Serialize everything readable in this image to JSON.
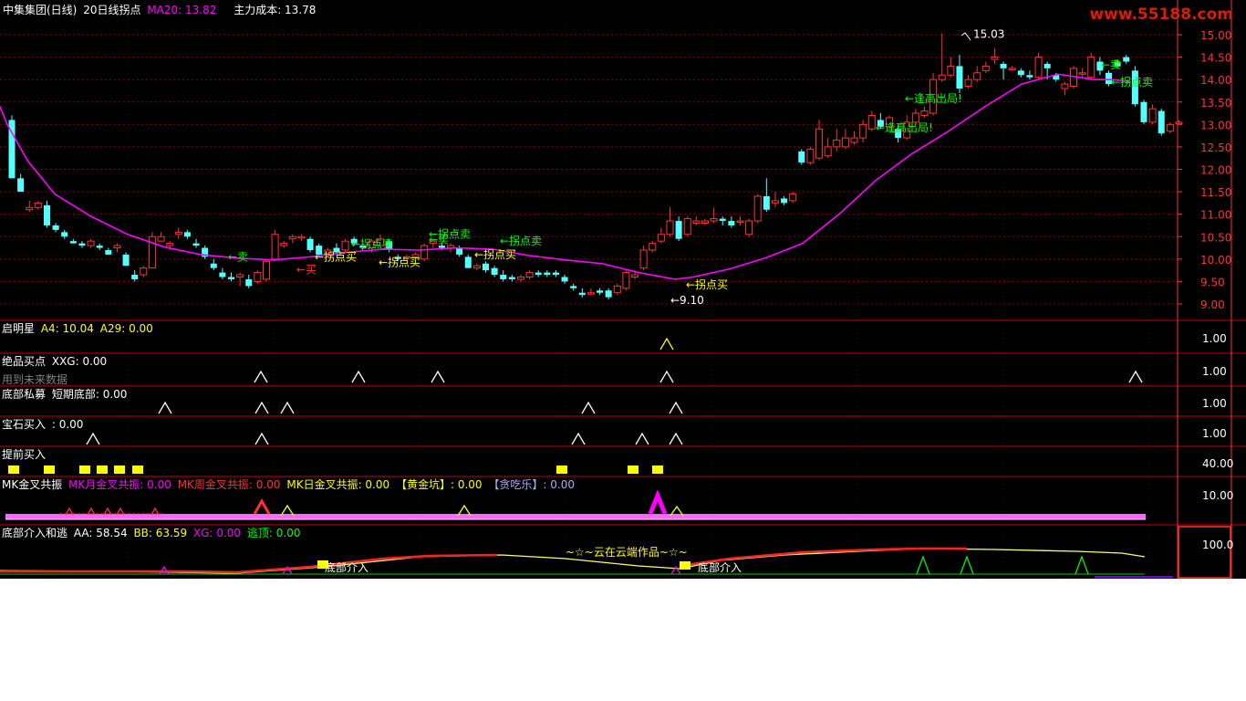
{
  "header": {
    "stock": "中集集团(日线)",
    "indicator": "20日线拐点",
    "ma_label": "MA20: 13.82",
    "cost_label": "主力成本: 13.78"
  },
  "watermark": "www.55188.com",
  "panels": {
    "p1": {
      "title": "启明星",
      "a": "A4: 10.04",
      "b": "A29: 0.00",
      "axis": "1.00"
    },
    "p2": {
      "title": "绝品买点",
      "a": "XXG: 0.00",
      "note": "用到未来数据",
      "axis": "1.00"
    },
    "p3": {
      "title": "底部私募",
      "a": "短期底部: 0.00",
      "axis": "1.00"
    },
    "p4": {
      "title": "宝石买入",
      "a": ": 0.00",
      "axis": "1.00"
    },
    "p5": {
      "title": "提前买入",
      "axis": "40.00"
    },
    "p6": {
      "title": "MK金叉共振",
      "a": "MK月金叉共振: 0.00",
      "b": "MK周金叉共振: 0.00",
      "c": "MK日金叉共振: 0.00",
      "d": "【黄金坑】: 0.00",
      "e": "【贪吃乐】: 0.00",
      "axis": "10.00"
    },
    "p7": {
      "title": "底部介入和逃",
      "a": "AA: 58.54",
      "b": "BB: 63.59",
      "c": "XG: 0.00",
      "d": "逃顶: 0.00",
      "axis": "100.0",
      "credit": "~☆~云在云端作品~☆~"
    }
  },
  "colors": {
    "up": "#ff3232",
    "down": "#54ffff",
    "ma": "#ff00ff",
    "grid": "#8b0000",
    "axis": "#ff3232",
    "gold": "#ffff00",
    "green": "#00ff00"
  },
  "chart_data": {
    "type": "candlestick",
    "ylim": [
      8.8,
      15.2
    ],
    "yticks": [
      "9.00",
      "9.50",
      "10.00",
      "10.50",
      "11.00",
      "11.50",
      "12.00",
      "12.50",
      "13.00",
      "13.50",
      "14.00",
      "14.50",
      "15.00"
    ],
    "candles": [
      [
        13.1,
        13.2,
        11.8,
        11.8
      ],
      [
        11.8,
        11.9,
        11.5,
        11.5
      ],
      [
        11.1,
        11.3,
        11.05,
        11.15
      ],
      [
        11.15,
        11.3,
        11.1,
        11.25
      ],
      [
        11.2,
        11.3,
        10.7,
        10.75
      ],
      [
        10.75,
        10.8,
        10.6,
        10.65
      ],
      [
        10.6,
        10.65,
        10.45,
        10.5
      ],
      [
        10.4,
        10.45,
        10.35,
        10.35
      ],
      [
        10.35,
        10.4,
        10.25,
        10.3
      ],
      [
        10.3,
        10.45,
        10.25,
        10.4
      ],
      [
        10.3,
        10.35,
        10.2,
        10.25
      ],
      [
        10.2,
        10.25,
        10.1,
        10.1
      ],
      [
        10.25,
        10.35,
        10.15,
        10.3
      ],
      [
        10.1,
        10.15,
        9.85,
        9.85
      ],
      [
        9.65,
        9.75,
        9.5,
        9.55
      ],
      [
        9.65,
        9.85,
        9.6,
        9.8
      ],
      [
        9.8,
        10.6,
        9.8,
        10.5
      ],
      [
        10.4,
        10.6,
        10.4,
        10.5
      ],
      [
        10.3,
        10.4,
        10.2,
        10.35
      ],
      [
        10.55,
        10.7,
        10.45,
        10.6
      ],
      [
        10.6,
        10.65,
        10.45,
        10.5
      ],
      [
        10.35,
        10.45,
        10.25,
        10.3
      ],
      [
        10.25,
        10.3,
        10.0,
        10.05
      ],
      [
        9.9,
        10.0,
        9.75,
        9.8
      ],
      [
        9.7,
        9.8,
        9.55,
        9.6
      ],
      [
        9.6,
        9.7,
        9.5,
        9.55
      ],
      [
        9.6,
        9.7,
        9.4,
        9.65
      ],
      [
        9.55,
        9.65,
        9.35,
        9.4
      ],
      [
        9.5,
        9.75,
        9.45,
        9.7
      ],
      [
        9.55,
        10.0,
        9.5,
        9.95
      ],
      [
        10.0,
        10.65,
        9.95,
        10.55
      ],
      [
        10.3,
        10.4,
        10.25,
        10.35
      ],
      [
        10.45,
        10.55,
        10.35,
        10.5
      ],
      [
        10.5,
        10.55,
        10.4,
        10.5
      ],
      [
        10.45,
        10.5,
        10.15,
        10.2
      ],
      [
        10.3,
        10.35,
        10.05,
        10.1
      ],
      [
        10.1,
        10.25,
        10.05,
        10.2
      ],
      [
        10.25,
        10.35,
        10.1,
        10.15
      ],
      [
        10.2,
        10.45,
        10.15,
        10.4
      ],
      [
        10.45,
        10.5,
        10.3,
        10.35
      ],
      [
        10.3,
        10.35,
        10.2,
        10.25
      ],
      [
        10.25,
        10.45,
        10.15,
        10.4
      ],
      [
        10.3,
        10.55,
        10.25,
        10.45
      ],
      [
        10.4,
        10.45,
        10.15,
        10.2
      ],
      [
        10.05,
        10.1,
        9.95,
        10.0
      ],
      [
        10.05,
        10.1,
        9.95,
        10.05
      ],
      [
        10.05,
        10.15,
        10.0,
        10.1
      ],
      [
        10.0,
        10.35,
        9.95,
        10.3
      ],
      [
        10.35,
        10.45,
        10.25,
        10.4
      ],
      [
        10.3,
        10.35,
        10.2,
        10.25
      ],
      [
        10.25,
        10.35,
        10.15,
        10.3
      ],
      [
        10.25,
        10.3,
        10.05,
        10.1
      ],
      [
        10.05,
        10.1,
        9.8,
        9.8
      ],
      [
        9.8,
        9.9,
        9.75,
        9.85
      ],
      [
        9.9,
        9.95,
        9.7,
        9.75
      ],
      [
        9.8,
        9.85,
        9.6,
        9.65
      ],
      [
        9.65,
        9.75,
        9.5,
        9.55
      ],
      [
        9.6,
        9.65,
        9.5,
        9.55
      ],
      [
        9.55,
        9.65,
        9.5,
        9.6
      ],
      [
        9.6,
        9.75,
        9.55,
        9.7
      ],
      [
        9.7,
        9.75,
        9.6,
        9.65
      ],
      [
        9.7,
        9.75,
        9.6,
        9.65
      ],
      [
        9.7,
        9.75,
        9.6,
        9.65
      ],
      [
        9.6,
        9.65,
        9.45,
        9.5
      ],
      [
        9.4,
        9.45,
        9.3,
        9.35
      ],
      [
        9.25,
        9.35,
        9.15,
        9.2
      ],
      [
        9.25,
        9.35,
        9.2,
        9.25
      ],
      [
        9.3,
        9.35,
        9.2,
        9.25
      ],
      [
        9.3,
        9.35,
        9.1,
        9.15
      ],
      [
        9.25,
        9.45,
        9.2,
        9.4
      ],
      [
        9.35,
        9.75,
        9.3,
        9.7
      ],
      [
        9.6,
        9.75,
        9.55,
        9.65
      ],
      [
        9.8,
        10.3,
        9.75,
        10.2
      ],
      [
        10.2,
        10.4,
        10.15,
        10.35
      ],
      [
        10.4,
        10.7,
        10.35,
        10.55
      ],
      [
        10.55,
        11.15,
        10.5,
        10.85
      ],
      [
        10.85,
        10.95,
        10.4,
        10.45
      ],
      [
        10.55,
        10.95,
        10.5,
        10.9
      ],
      [
        10.8,
        10.95,
        10.75,
        10.85
      ],
      [
        10.8,
        10.9,
        10.75,
        10.85
      ],
      [
        10.85,
        11.15,
        10.8,
        10.9
      ],
      [
        10.9,
        10.95,
        10.75,
        10.85
      ],
      [
        10.85,
        10.95,
        10.7,
        10.75
      ],
      [
        10.85,
        10.95,
        10.75,
        10.85
      ],
      [
        10.55,
        10.9,
        10.5,
        10.85
      ],
      [
        10.85,
        11.45,
        10.8,
        11.4
      ],
      [
        11.4,
        11.8,
        11.05,
        11.1
      ],
      [
        11.25,
        11.5,
        11.15,
        11.3
      ],
      [
        11.35,
        11.4,
        11.2,
        11.25
      ],
      [
        11.3,
        11.5,
        11.25,
        11.45
      ],
      [
        12.4,
        12.45,
        12.1,
        12.15
      ],
      [
        12.15,
        12.5,
        12.1,
        12.45
      ],
      [
        12.25,
        13.1,
        12.2,
        12.9
      ],
      [
        12.3,
        12.7,
        12.25,
        12.5
      ],
      [
        12.5,
        12.9,
        12.4,
        12.65
      ],
      [
        12.5,
        12.9,
        12.45,
        12.7
      ],
      [
        12.6,
        12.85,
        12.55,
        12.7
      ],
      [
        12.7,
        13.1,
        12.6,
        13.0
      ],
      [
        12.9,
        13.3,
        12.85,
        13.2
      ],
      [
        13.1,
        13.25,
        12.9,
        12.95
      ],
      [
        12.95,
        13.2,
        12.9,
        13.15
      ],
      [
        12.9,
        13.0,
        12.6,
        12.7
      ],
      [
        12.7,
        13.2,
        12.65,
        13.05
      ],
      [
        13.05,
        13.35,
        13.0,
        13.25
      ],
      [
        13.2,
        13.4,
        13.15,
        13.3
      ],
      [
        13.25,
        14.15,
        13.2,
        14.0
      ],
      [
        14.0,
        15.03,
        13.95,
        14.1
      ],
      [
        14.1,
        14.5,
        14.05,
        14.3
      ],
      [
        14.3,
        14.55,
        13.7,
        13.8
      ],
      [
        13.85,
        14.1,
        13.8,
        14.0
      ],
      [
        14.0,
        14.3,
        13.95,
        14.15
      ],
      [
        14.2,
        14.4,
        14.15,
        14.3
      ],
      [
        14.45,
        14.7,
        14.35,
        14.5
      ],
      [
        14.35,
        14.4,
        14.0,
        14.25
      ],
      [
        14.25,
        14.3,
        14.2,
        14.25
      ],
      [
        14.2,
        14.25,
        14.05,
        14.1
      ],
      [
        14.1,
        14.2,
        14.0,
        14.05
      ],
      [
        14.05,
        14.6,
        14.0,
        14.5
      ],
      [
        14.35,
        14.4,
        14.0,
        14.25
      ],
      [
        14.1,
        14.15,
        13.95,
        14.0
      ],
      [
        13.8,
        13.95,
        13.65,
        13.9
      ],
      [
        13.85,
        14.3,
        13.8,
        14.25
      ],
      [
        14.15,
        14.25,
        14.05,
        14.15
      ],
      [
        14.05,
        14.6,
        14.0,
        14.5
      ],
      [
        14.4,
        14.5,
        14.1,
        14.2
      ],
      [
        14.15,
        14.2,
        13.85,
        13.9
      ],
      [
        14.4,
        14.45,
        14.25,
        14.3
      ],
      [
        14.5,
        14.55,
        14.35,
        14.4
      ],
      [
        14.2,
        14.3,
        13.4,
        13.45
      ],
      [
        13.5,
        13.55,
        13.0,
        13.05
      ],
      [
        13.05,
        13.45,
        13.0,
        13.35
      ],
      [
        13.3,
        13.35,
        12.75,
        12.8
      ],
      [
        12.85,
        13.05,
        12.8,
        13.0
      ],
      [
        13.05,
        13.1,
        13.0,
        13.05
      ]
    ],
    "ma20": [
      [
        0,
        13.4
      ],
      [
        8,
        13.0
      ],
      [
        30,
        12.2
      ],
      [
        60,
        11.45
      ],
      [
        100,
        10.95
      ],
      [
        140,
        10.55
      ],
      [
        180,
        10.27
      ],
      [
        220,
        10.1
      ],
      [
        260,
        10.02
      ],
      [
        300,
        9.98
      ],
      [
        340,
        10.05
      ],
      [
        380,
        10.15
      ],
      [
        420,
        10.22
      ],
      [
        460,
        10.2
      ],
      [
        500,
        10.25
      ],
      [
        540,
        10.22
      ],
      [
        580,
        10.08
      ],
      [
        620,
        9.98
      ],
      [
        660,
        9.9
      ],
      [
        700,
        9.7
      ],
      [
        740,
        9.55
      ],
      [
        760,
        9.6
      ],
      [
        800,
        9.78
      ],
      [
        840,
        10.03
      ],
      [
        880,
        10.35
      ],
      [
        920,
        11.0
      ],
      [
        960,
        11.75
      ],
      [
        1000,
        12.35
      ],
      [
        1040,
        12.85
      ],
      [
        1080,
        13.4
      ],
      [
        1120,
        13.9
      ],
      [
        1160,
        14.12
      ],
      [
        1200,
        14.0
      ],
      [
        1220,
        14.0
      ],
      [
        1240,
        13.95
      ]
    ],
    "annotations": [
      {
        "text": "15.03",
        "color": "#ffffff",
        "x": 1067,
        "y": 15.03
      },
      {
        "text": "←9.10",
        "color": "#ffffff",
        "x": 735,
        "y": 9.1
      },
      {
        "text": "←卖",
        "color": "#00ff00",
        "x": 250,
        "y": 10.07
      },
      {
        "text": "←买",
        "color": "#ff3232",
        "x": 325,
        "y": 9.78
      },
      {
        "text": "←拐点卖",
        "color": "#00ff00",
        "x": 385,
        "y": 10.35
      },
      {
        "text": "←拐点买",
        "color": "#ffff00",
        "x": 345,
        "y": 10.07
      },
      {
        "text": "←拐点买",
        "color": "#ffff00",
        "x": 415,
        "y": 9.95
      },
      {
        "text": "←卖",
        "color": "#00ff00",
        "x": 470,
        "y": 10.45
      },
      {
        "text": "←拐点卖",
        "color": "#00ff00",
        "x": 470,
        "y": 10.58
      },
      {
        "text": "←拐点买",
        "color": "#ffff00",
        "x": 520,
        "y": 10.12
      },
      {
        "text": "←拐点卖",
        "color": "#00ff00",
        "x": 548,
        "y": 10.42
      },
      {
        "text": "←拐点买",
        "color": "#ffff00",
        "x": 752,
        "y": 9.45
      },
      {
        "text": "←逢高出局!",
        "color": "#00ff00",
        "x": 960,
        "y": 12.95
      },
      {
        "text": "←逢高出局!",
        "color": "#00ff00",
        "x": 992,
        "y": 13.6
      },
      {
        "text": "←卖",
        "color": "#00ff00",
        "x": 1207,
        "y": 14.35
      },
      {
        "text": "←拐点卖",
        "color": "#00ff00",
        "x": 1218,
        "y": 13.96
      }
    ]
  }
}
